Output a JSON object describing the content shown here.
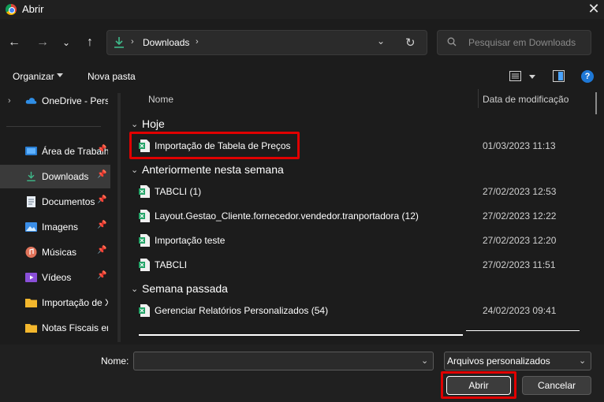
{
  "window": {
    "title": "Abrir"
  },
  "nav": {
    "back_icon": "arrow-left-icon",
    "forward_icon": "arrow-right-icon",
    "recent_icon": "chevron-down-icon",
    "up_icon": "arrow-up-icon"
  },
  "address": {
    "location": "Downloads"
  },
  "search": {
    "placeholder": "Pesquisar em Downloads"
  },
  "toolbar": {
    "organize": "Organizar",
    "new_folder": "Nova pasta"
  },
  "sidebar": {
    "items": [
      {
        "label": "OneDrive - Perso",
        "icon": "cloud-icon",
        "pinned": false
      },
      {
        "label": "Área de Trabalho",
        "icon": "desktop-icon",
        "pinned": true
      },
      {
        "label": "Downloads",
        "icon": "download-icon",
        "pinned": true,
        "selected": true
      },
      {
        "label": "Documentos",
        "icon": "document-icon",
        "pinned": true
      },
      {
        "label": "Imagens",
        "icon": "image-icon",
        "pinned": true
      },
      {
        "label": "Músicas",
        "icon": "music-icon",
        "pinned": true
      },
      {
        "label": "Vídeos",
        "icon": "video-icon",
        "pinned": true
      },
      {
        "label": "Importação de Xml",
        "icon": "folder-icon",
        "pinned": false
      },
      {
        "label": "Notas Fiscais em",
        "icon": "folder-icon",
        "pinned": false
      }
    ]
  },
  "columns": {
    "name": "Nome",
    "date": "Data de modificação"
  },
  "groups": [
    {
      "label": "Hoje",
      "files": [
        {
          "name": "Importação de Tabela de Preços",
          "date": "01/03/2023 11:13"
        }
      ]
    },
    {
      "label": "Anteriormente nesta semana",
      "files": [
        {
          "name": "TABCLI (1)",
          "date": "27/02/2023 12:53"
        },
        {
          "name": "Layout.Gestao_Cliente.fornecedor.vendedor.tranportadora (12)",
          "date": "27/02/2023 12:22"
        },
        {
          "name": "Importação teste",
          "date": "27/02/2023 12:20"
        },
        {
          "name": "TABCLI",
          "date": "27/02/2023 11:51"
        }
      ]
    },
    {
      "label": "Semana passada",
      "files": [
        {
          "name": "Gerenciar Relatórios Personalizados (54)",
          "date": "24/02/2023 09:41"
        }
      ]
    }
  ],
  "footer": {
    "name_label": "Nome:",
    "name_value": "",
    "file_type": "Arquivos personalizados",
    "open_button": "Abrir",
    "cancel_button": "Cancelar"
  },
  "colors": {
    "accent": "#4aa3ff",
    "highlight": "#e00000",
    "excel_green": "#21a366"
  }
}
